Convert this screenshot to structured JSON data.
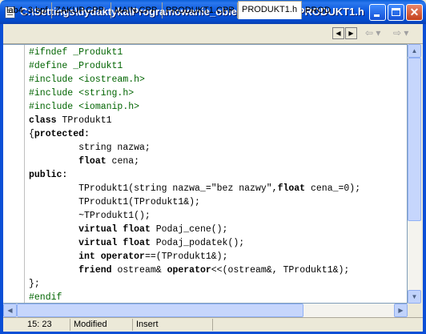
{
  "window": {
    "title": "C:\\Settings\\dydaktyka\\Programowanie_obiektowe\\w4_3\\PRODUKT1.h"
  },
  "tabs": [
    {
      "label": "lab4_3.bpf"
    },
    {
      "label": "ZAKUP.CPP"
    },
    {
      "label": "MAIN.CPP"
    },
    {
      "label": "PRODUKT1.CPP"
    },
    {
      "label": "PRODUKT1.h",
      "active": true
    },
    {
      "label": "PROD"
    }
  ],
  "nav": {
    "back_icon": "arrow-left-icon",
    "forward_icon": "arrow-right-icon"
  },
  "code_lines": [
    [
      {
        "t": "#ifndef _Produkt1",
        "c": "pp"
      }
    ],
    [
      {
        "t": "#define _Produkt1",
        "c": "pp"
      }
    ],
    [
      {
        "t": "#include <iostream.h>",
        "c": "pp"
      }
    ],
    [
      {
        "t": "#include <string.h>",
        "c": "pp"
      }
    ],
    [
      {
        "t": "#include <iomanip.h>",
        "c": "pp"
      }
    ],
    [
      {
        "t": "class",
        "c": "kw"
      },
      {
        "t": " TProdukt1"
      }
    ],
    [
      {
        "t": "{"
      },
      {
        "t": "protected:",
        "c": "kw"
      }
    ],
    [
      {
        "t": "         string nazwa;"
      }
    ],
    [
      {
        "t": "         "
      },
      {
        "t": "float",
        "c": "kw"
      },
      {
        "t": " cena;"
      }
    ],
    [
      {
        "t": "public:",
        "c": "kw"
      }
    ],
    [
      {
        "t": "         TProdukt1(string nazwa_="
      },
      {
        "t": "\"bez nazwy\"",
        "c": "str"
      },
      {
        "t": ","
      },
      {
        "t": "float",
        "c": "kw"
      },
      {
        "t": " cena_=0);"
      }
    ],
    [
      {
        "t": "         TProdukt1(TProdukt1&);"
      }
    ],
    [
      {
        "t": "         ~TProdukt1();"
      }
    ],
    [
      {
        "t": "         "
      },
      {
        "t": "virtual float",
        "c": "kw"
      },
      {
        "t": " Podaj_cene();"
      }
    ],
    [
      {
        "t": "         "
      },
      {
        "t": "virtual float",
        "c": "kw"
      },
      {
        "t": " Podaj_podatek();"
      }
    ],
    [
      {
        "t": "         "
      },
      {
        "t": "int operator",
        "c": "kw"
      },
      {
        "t": "==(TProdukt1&);"
      }
    ],
    [
      {
        "t": "         "
      },
      {
        "t": "friend",
        "c": "kw"
      },
      {
        "t": " ostream& "
      },
      {
        "t": "operator",
        "c": "kw"
      },
      {
        "t": "<<(ostream&, TProdukt1&);"
      }
    ],
    [
      {
        "t": "};"
      }
    ],
    [
      {
        "t": "#endif",
        "c": "pp"
      }
    ]
  ],
  "statusbar": {
    "position": "15: 23",
    "modified": "Modified",
    "mode": "Insert"
  },
  "colors": {
    "preprocessor": "#006400",
    "keyword": "#000000",
    "titlebar": "#0a5fd8"
  }
}
